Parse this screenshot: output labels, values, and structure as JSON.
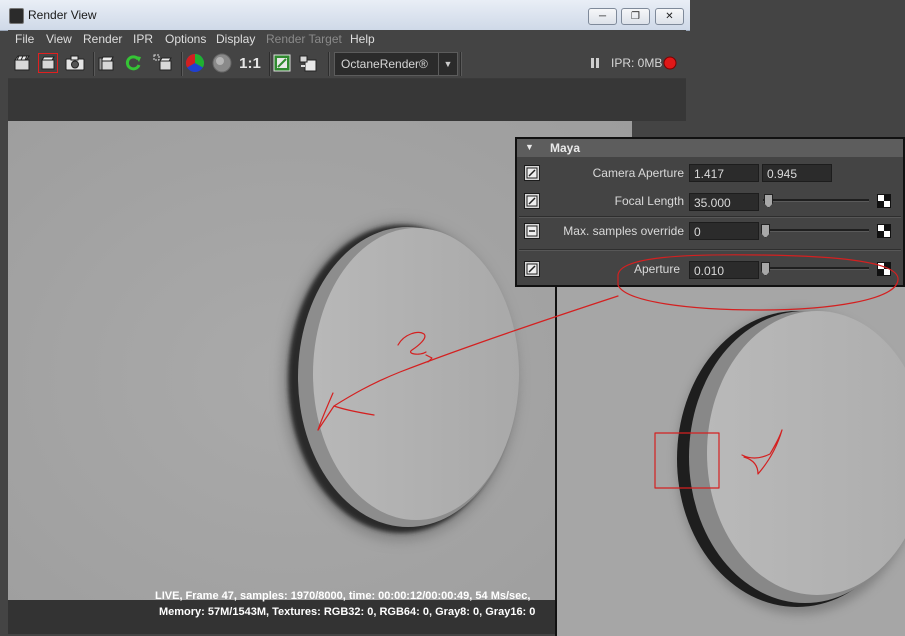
{
  "window": {
    "title": "Render View",
    "controls": [
      "minimize-icon",
      "restore-icon",
      "close-icon"
    ]
  },
  "menu": [
    "File",
    "View",
    "Render",
    "IPR",
    "Options",
    "Display",
    "Render Target",
    "Help"
  ],
  "menu_disabled": [
    "Render Target"
  ],
  "toolbar": {
    "icons": [
      "redo-render-icon",
      "render-region-icon",
      "snapshot-icon",
      "ipr-render-icon",
      "refresh-icon",
      "ipr-region-icon",
      "rgb-channels-icon",
      "alpha-channel-icon",
      "real-size-icon",
      "keep-image-icon",
      "remove-image-icon"
    ],
    "real_size_label": "1:1",
    "renderer": "OctaneRender®",
    "ipr_status": "IPR: 0MB",
    "pause_icon": "pause-icon",
    "stop_icon": "record-stop-icon"
  },
  "status": {
    "line1": "LIVE, Frame 47, samples: 1970/8000, time: 00:00:12/00:00:49, 54 Ms/sec,",
    "line2": "Memory: 57M/1543M, Textures: RGB32: 0, RGB64: 0, Gray8: 0, Gray16: 0"
  },
  "panel": {
    "header": "Maya",
    "rows": [
      {
        "label": "Camera Aperture",
        "value1": "1.417",
        "value2": "0.945"
      },
      {
        "label": "Focal Length",
        "value": "35.000",
        "slider": 0.03
      },
      {
        "label": "Max. samples override",
        "value": "0",
        "slider": 0.0
      },
      {
        "label": "Aperture",
        "value": "0.010",
        "slider": 0.0
      }
    ]
  },
  "colors": {
    "annotation_red": "#d42020",
    "render_bg": "#a9a9a9",
    "ui_dark": "#444444"
  }
}
